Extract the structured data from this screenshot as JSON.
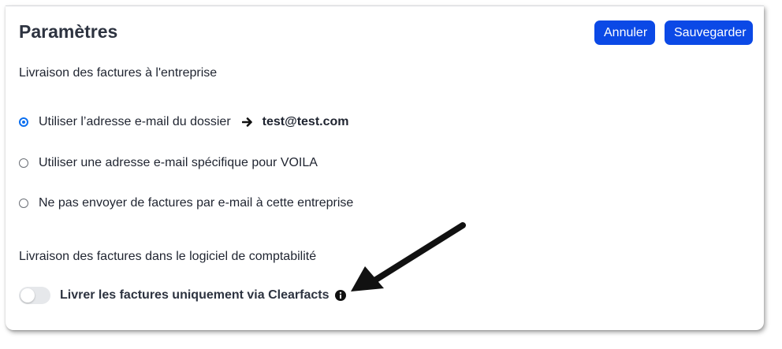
{
  "header": {
    "title": "Paramètres",
    "cancel_label": "Annuler",
    "save_label": "Sauvegarder"
  },
  "delivery_company": {
    "section_label": "Livraison des factures à l'entreprise",
    "options": [
      {
        "label": "Utiliser l’adresse e-mail du dossier",
        "email": "test@test.com",
        "selected": true
      },
      {
        "label": "Utiliser une adresse e-mail spécifique pour VOILA",
        "selected": false
      },
      {
        "label": "Ne pas envoyer de factures par e-mail à cette entreprise",
        "selected": false
      }
    ]
  },
  "delivery_accounting": {
    "section_label": "Livraison des factures dans le logiciel de comptabilité",
    "toggle_label": "Livrer les factures uniquement via Clearfacts",
    "toggle_on": false
  },
  "colors": {
    "primary": "#0b49e6",
    "radio_selected": "#0b6ff0",
    "toggle_off": "#e6e8eb",
    "text": "#1f2430"
  },
  "icons": {
    "arrow": "arrow-right-icon",
    "info": "info-circle-icon",
    "annotation": "annotation-arrow-icon"
  }
}
